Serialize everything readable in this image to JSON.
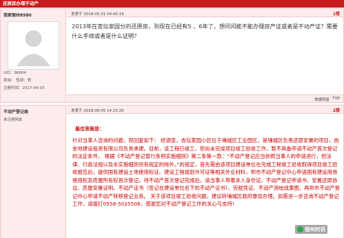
{
  "topbar": {
    "title": "还原房办理不动产"
  },
  "post1": {
    "username": "我家宿州8980",
    "uid": "UID：96604",
    "origin": "来自：  性别：男",
    "register": "注册时间：2017-04-03",
    "time": "发表于 2018-05-31 04:40:19",
    "floor": "1楼",
    "content": "2013年在杏坛家园分的还原房，到现在已经有5 、6年了，想问问能不能办理房产证或者是不动产证？需要什么手续或者是什么证明？",
    "quick_reply": "快速回复",
    "top": "TOP"
  },
  "post2": {
    "username": "不动产登记局",
    "status": "未注册网友",
    "time": "发表于 2018-06-05 14:23:26",
    "floor": "2楼",
    "best_label": "最佳答案是：",
    "content": "针对当事人咨询的问题，现回复如下： 经调查，杏坛家园小区位于埇城区工业园区，是埇城区负责还原安置的项目，由金地建设投资有限公司负责承建。目前，该工程已竣工，但尚未完成项目竣工验收工作，暂不具备申请不动产首次登记的法定条件。 根据《不动产登记暂行条例实施细则》第二条第一款：“不动产登记应当依照当事人的申请进行，但法律、行政法规以及本实施细则另有规定的除外。”的规定，首先需由该项目建设单位在完成工程竣工验收取得项目竣工验收报告后，提供国有建设土地使用权证、建设工程规划许可证等相关外业材料，到市不动产登记中心申请国有建设用地使用权及房屋所有权首次登记。待不动产首次登记完成后，请当事人带着本人身份证、不动产登记申请书、安置还原协议、房屋安置证明、不动产证书（签记在建设单位名下的不动产证书）、完税凭证、不动产测绘成果图，再到市不动产登记中心申请不动产转移登记业务。 关于该项目竣工验收问题，建议转埇城区政府督促办理。如需进一步咨询不动产登记工作，请拨打0558-5025506，感谢您对不动产登记工作的关心与支持！"
  },
  "watermark": {
    "text": "宿州时讯"
  }
}
